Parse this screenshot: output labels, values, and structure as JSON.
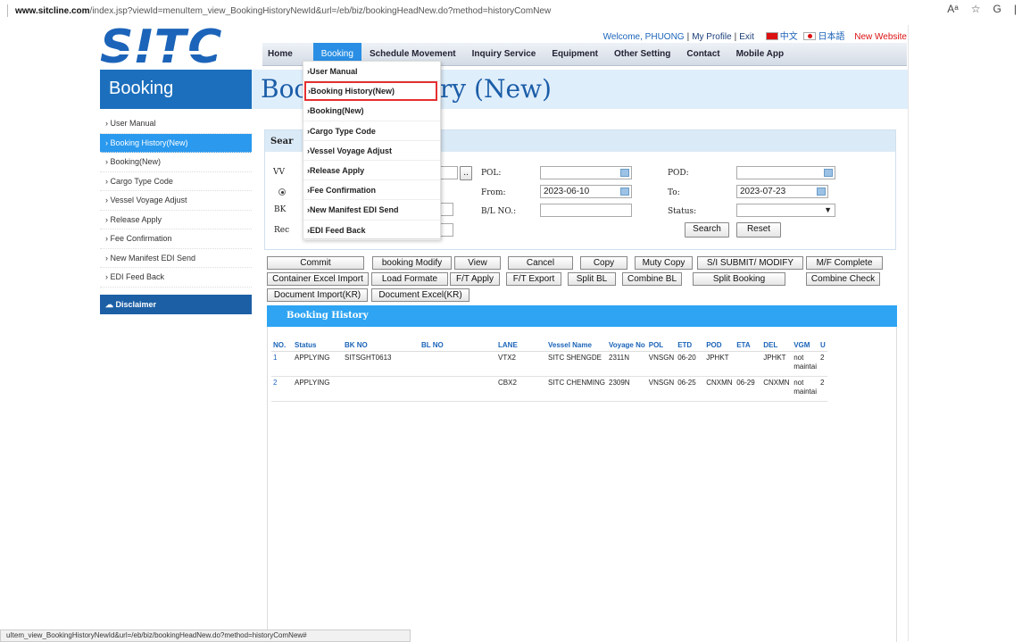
{
  "browser": {
    "url_host": "www.sitcline.com",
    "url_path": "/index.jsp?viewId=menuItem_view_BookingHistoryNewId&url=/eb/biz/bookingHeadNew.do?method=historyComNew",
    "icon_read": "Aᵃ",
    "icon_fav": "☆",
    "icon_refresh": "G",
    "icon_more": "|"
  },
  "site": {
    "logo": "SITC",
    "welcome": "Welcome, PHUONG",
    "my_profile": "My Profile",
    "exit": "Exit",
    "lang_cn": "中文",
    "lang_jp": "日本語",
    "new_website": "New Website",
    "nav": [
      "Home",
      "Booking",
      "Schedule Movement",
      "Inquiry Service",
      "Equipment",
      "Other Setting",
      "Contact",
      "Mobile App"
    ]
  },
  "title_band": {
    "side": "Booking",
    "page_title": "Booking History (New)"
  },
  "leftmenu": {
    "items": [
      "› User Manual",
      "› Booking History(New)",
      "› Booking(New)",
      "› Cargo Type Code",
      "› Vessel Voyage Adjust",
      "› Release Apply",
      "› Fee Confirmation",
      "› New Manifest EDI Send",
      "› EDI Feed Back"
    ],
    "disclaimer": "Disclaimer"
  },
  "dropdown": {
    "items": [
      "›User Manual",
      "›Booking History(New)",
      "›Booking(New)",
      "›Cargo Type Code",
      "›Vessel Voyage Adjust",
      "›Release Apply",
      "›Fee Confirmation",
      "›New Manifest EDI Send",
      "›EDI Feed Back"
    ]
  },
  "search": {
    "header": "Sear",
    "lbl_vv": "VV",
    "lbl_bk": "BK",
    "lbl_rec": "Rec",
    "lbl_pol": "POL:",
    "lbl_pod": "POD:",
    "lbl_from": "From:",
    "lbl_to": "To:",
    "lbl_bl": "B/L NO.:",
    "lbl_status": "Status:",
    "from_value": "2023-06-10",
    "to_value": "2023-07-23",
    "dots": "..",
    "search_btn": "Search",
    "reset_btn": "Reset"
  },
  "actions": {
    "row1": [
      "Commit",
      "booking Modify",
      "View",
      "Cancel",
      "Copy",
      "Muty Copy",
      "S/I SUBMIT/ MODIFY",
      "M/F Complete"
    ],
    "row2": [
      "Container Excel Import",
      "Load Formate",
      "F/T Apply",
      "F/T Export",
      "Split BL",
      "Combine BL",
      "Split Booking",
      "Combine Check"
    ],
    "row3": [
      "Document Import(KR)",
      "Document Excel(KR)"
    ]
  },
  "history": {
    "header": "Booking History",
    "columns": [
      "NO.",
      "Status",
      "BK NO",
      "BL NO",
      "LANE",
      "Vessel Name",
      "Voyage No",
      "POL",
      "ETD",
      "POD",
      "ETA",
      "DEL",
      "VGM",
      "U"
    ],
    "rows": [
      [
        "1",
        "APPLYING",
        "SITSGHT0613",
        "",
        "VTX2",
        "SITC SHENGDE",
        "2311N",
        "VNSGN",
        "06-20",
        "JPHKT",
        "",
        "JPHKT",
        "not maintai",
        "2"
      ],
      [
        "2",
        "APPLYING",
        "",
        "",
        "CBX2",
        "SITC CHENMING",
        "2309N",
        "VNSGN",
        "06-25",
        "CNXMN",
        "06-29",
        "CNXMN",
        "not maintai",
        "2"
      ]
    ]
  },
  "statusbar": "uItem_view_BookingHistoryNewId&url=/eb/biz/bookingHeadNew.do?method=historyComNew#"
}
